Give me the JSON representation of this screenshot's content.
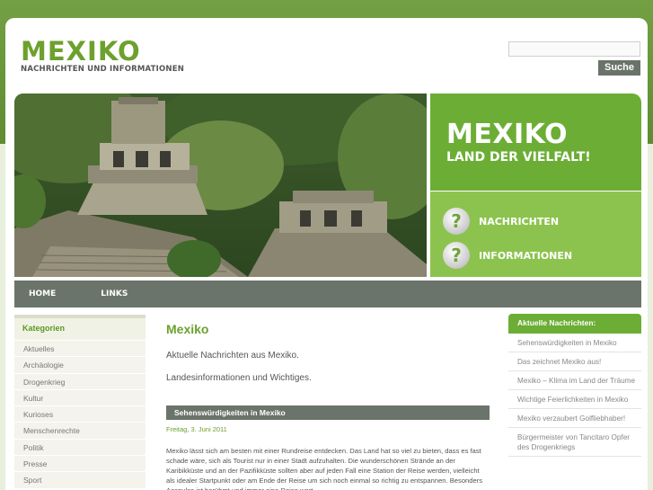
{
  "site": {
    "logo_title": "MEXIKO",
    "logo_subtitle": "NACHRICHTEN UND INFORMATIONEN"
  },
  "search": {
    "value": "",
    "button_label": "Suche"
  },
  "hero": {
    "title": "MEXIKO",
    "subtitle": "LAND DER VIELFALT!",
    "links": [
      {
        "icon": "?",
        "label": "NACHRICHTEN"
      },
      {
        "icon": "?",
        "label": "INFORMATIONEN"
      }
    ]
  },
  "nav": {
    "items": [
      "HOME",
      "LINKS"
    ]
  },
  "sidebar": {
    "title": "Kategorien",
    "items": [
      "Aktuelles",
      "Archäologie",
      "Drogenkrieg",
      "Kultur",
      "Kurioses",
      "Menschenrechte",
      "Politik",
      "Presse",
      "Sport"
    ]
  },
  "main": {
    "title": "Mexiko",
    "intro": "Aktuelle Nachrichten aus Mexiko.",
    "intro2": "Landesinformationen und Wichtiges.",
    "article": {
      "title": "Sehenswürdigkeiten in Mexiko",
      "date": "Freitag, 3. Juni 2011",
      "body": "Mexiko lässt sich am besten mit einer Rundreise entdecken. Das Land hat so viel zu bieten, dass es fast schade wäre, sich als Tourist nur in einer Stadt aufzuhalten. Die wunderschönen Strände an der Karibikküste und an der Pazifikküste sollten aber auf jeden Fall eine Station der Reise werden, vielleicht als idealer Startpunkt oder am Ende der Reise um sich noch einmal so richtig zu entspannen. Besonders Acapulco ist berühmt und immer eine Reise wert."
    }
  },
  "news": {
    "title": "Aktuelle Nachrichten:",
    "items": [
      "Sehenswürdigkeiten in Mexiko",
      "Das zeichnet Mexiko aus!",
      "Mexiko – Klima im Land der Träume",
      "Wichtige Feierlichkeiten in Mexiko",
      "Mexiko verzaubert Golfliebhaber!",
      "Bürgermeister von Tancitaro Opfer des Drogenkriegs"
    ]
  },
  "colors": {
    "accent_green": "#6ca12d",
    "nav_gray": "#6b746a",
    "background_green": "#6f9a3f"
  }
}
